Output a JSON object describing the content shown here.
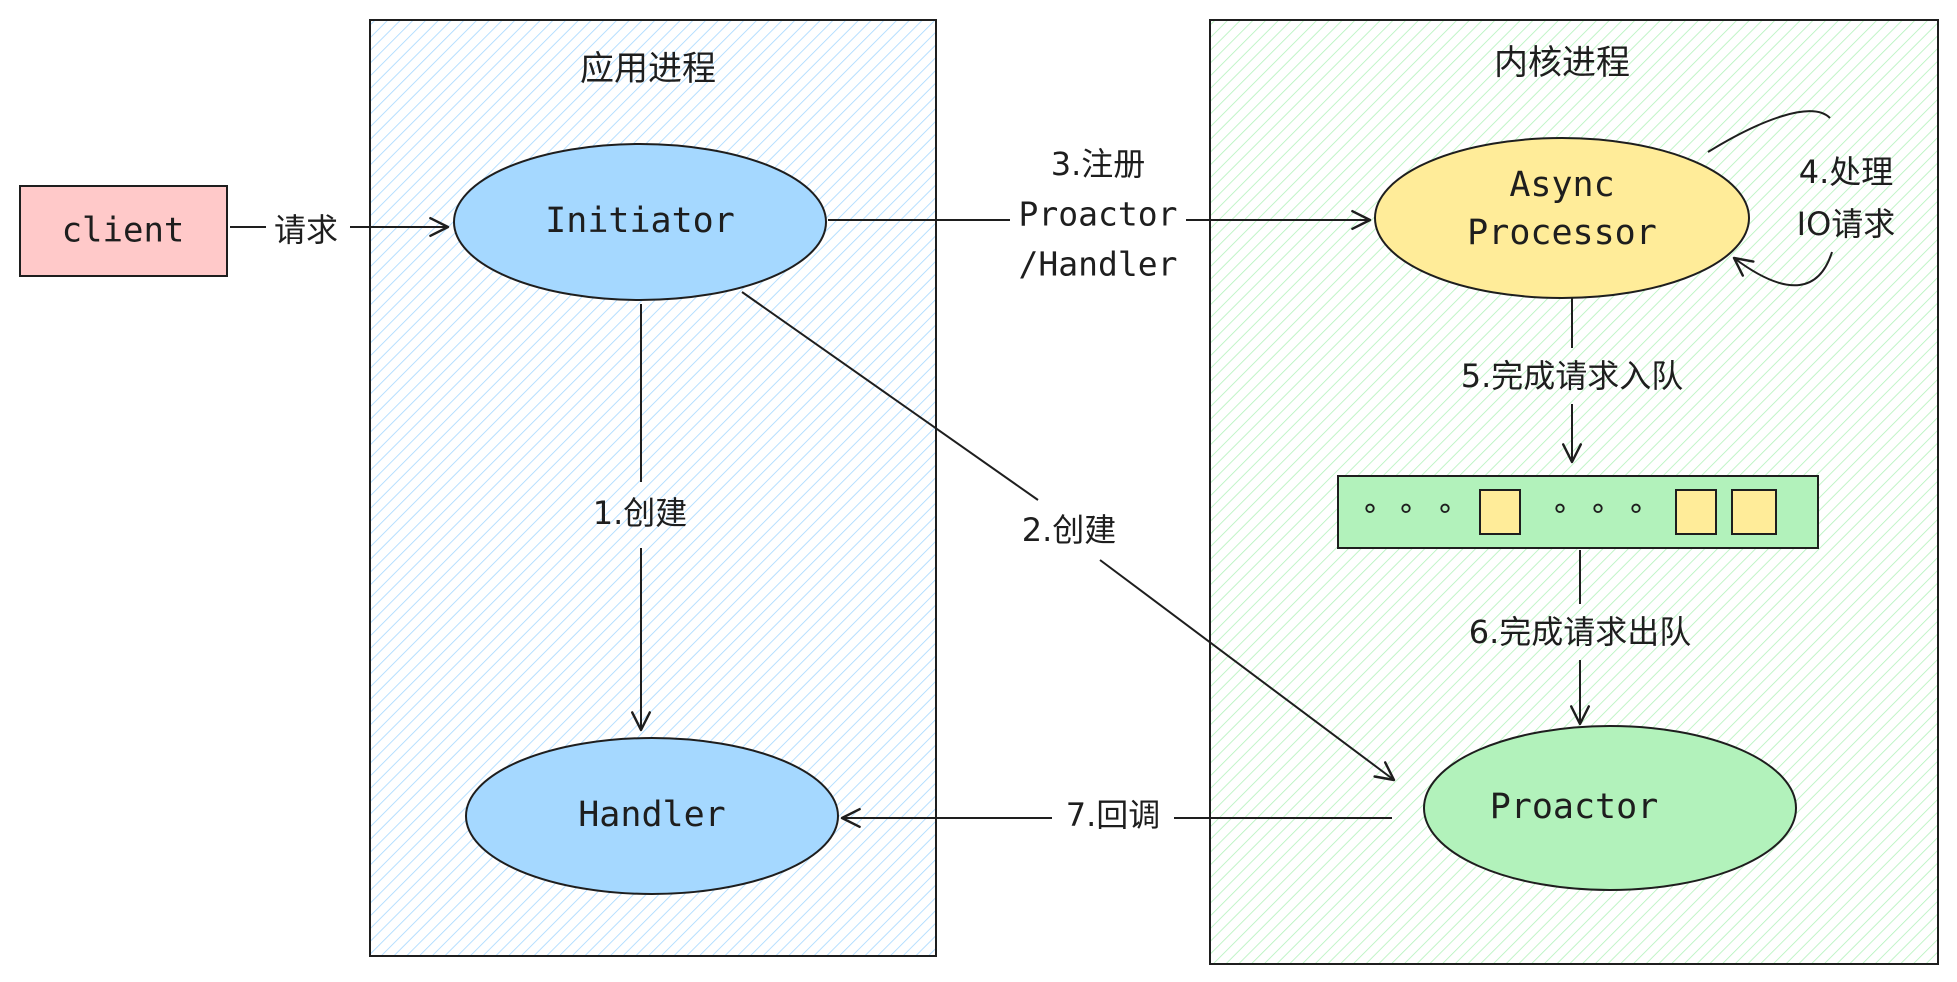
{
  "panels": {
    "app": {
      "title": "应用进程",
      "fill": "#a5d8ff"
    },
    "kernel": {
      "title": "内核进程",
      "fill": "#b2f2bb"
    }
  },
  "nodes": {
    "client": {
      "label": "client",
      "fill": "#ffc9c9"
    },
    "initiator": {
      "label": "Initiator",
      "fill": "#a5d8ff"
    },
    "handler": {
      "label": "Handler",
      "fill": "#a5d8ff"
    },
    "async_processor": {
      "line1": "Async",
      "line2": "Processor",
      "fill": "#ffec99"
    },
    "proactor": {
      "label": "Proactor",
      "fill": "#b2f2bb"
    },
    "queue": {
      "fill": "#b2f2bb",
      "slot_fill": "#ffec99",
      "dots": [
        "°",
        "°",
        "°",
        "°",
        "°",
        "°"
      ]
    }
  },
  "edges": {
    "request": "请求",
    "create_handler": "1.创建",
    "create_proactor": "2.创建",
    "register_line1": "3.注册",
    "register_line2": "Proactor",
    "register_line3": "/Handler",
    "process_line1": "4.处理",
    "process_line2": "IO请求",
    "enqueue": "5.完成请求入队",
    "dequeue": "6.完成请求出队",
    "callback": "7.回调"
  },
  "colors": {
    "stroke": "#1e1e1e"
  }
}
